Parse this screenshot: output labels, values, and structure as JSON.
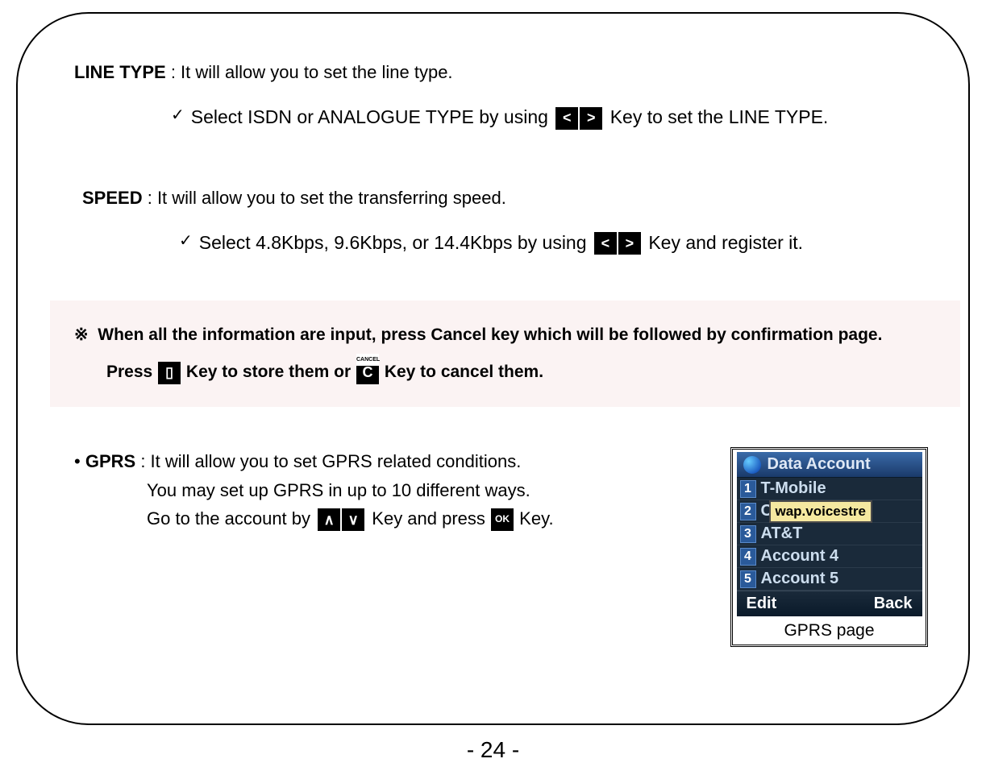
{
  "line_type": {
    "label": "LINE TYPE",
    "desc": ": It will allow you to set the line type.",
    "check_before": "Select ISDN or ANALOGUE TYPE by using",
    "check_after": "Key to set the LINE TYPE."
  },
  "speed": {
    "label": "SPEED",
    "desc": ": It will allow you to set the transferring speed.",
    "check_before": "Select 4.8Kbps, 9.6Kbps, or 14.4Kbps by using",
    "check_after": "Key and register it."
  },
  "note": {
    "marker": "※",
    "line1": "When all the information are input, press Cancel key which will be followed by confirmation page.",
    "line2a": "Press",
    "line2b": "Key to store them or",
    "line2c": "Key to cancel them."
  },
  "gprs": {
    "bullet": "•",
    "label": "GPRS",
    "desc": ": It will allow you to set GPRS related conditions.",
    "line2": "You may set up GPRS in up to 10 different ways.",
    "line3a": "Go to the account by",
    "line3b": "Key and press",
    "line3c": "Key."
  },
  "phone": {
    "title": "Data Account",
    "rows": [
      {
        "n": "1",
        "label": "T-Mobile"
      },
      {
        "n": "2",
        "label": "C"
      },
      {
        "n": "3",
        "label": "AT&T"
      },
      {
        "n": "4",
        "label": "Account 4"
      },
      {
        "n": "5",
        "label": "Account 5"
      }
    ],
    "tooltip": "wap.voicestre",
    "soft_left": "Edit",
    "soft_right": "Back",
    "caption": "GPRS page"
  },
  "keys": {
    "left": "<",
    "right": ">",
    "up": "∧",
    "down": "∨",
    "ok": "OK",
    "cancel_top": "CANCEL",
    "cancel": "C",
    "store": "▯"
  },
  "page_number": "- 24 -"
}
